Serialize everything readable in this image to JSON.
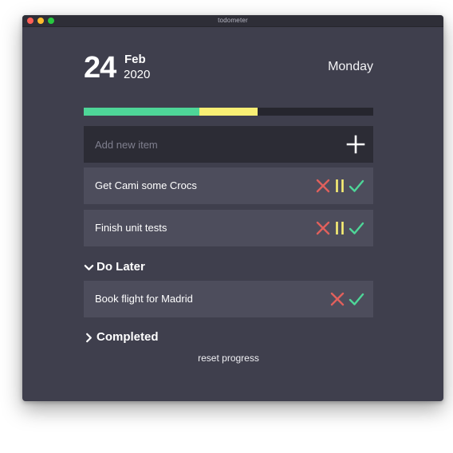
{
  "window": {
    "title": "todometer"
  },
  "date": {
    "day": "24",
    "month": "Feb",
    "year": "2020",
    "weekday": "Monday"
  },
  "progress": {
    "completed_fraction": 0.4,
    "paused_fraction": 0.2,
    "completed_color": "#4ed698",
    "paused_color": "#f9ef74",
    "track_color": "#26262e"
  },
  "add_item": {
    "placeholder": "Add new item",
    "value": "",
    "icon": "plus-icon"
  },
  "todo": {
    "items": [
      {
        "label": "Get Cami some Crocs",
        "actions": [
          "delete-icon",
          "pause-icon",
          "check-icon"
        ]
      },
      {
        "label": "Finish unit tests",
        "actions": [
          "delete-icon",
          "pause-icon",
          "check-icon"
        ]
      }
    ]
  },
  "do_later": {
    "heading": "Do Later",
    "expanded": true,
    "items": [
      {
        "label": "Book flight for Madrid",
        "actions": [
          "delete-icon",
          "check-icon"
        ]
      }
    ]
  },
  "completed": {
    "heading": "Completed",
    "expanded": false
  },
  "reset": {
    "label": "reset progress"
  },
  "colors": {
    "delete": "#e0605c",
    "pause": "#f9ef74",
    "check": "#4ed698"
  }
}
